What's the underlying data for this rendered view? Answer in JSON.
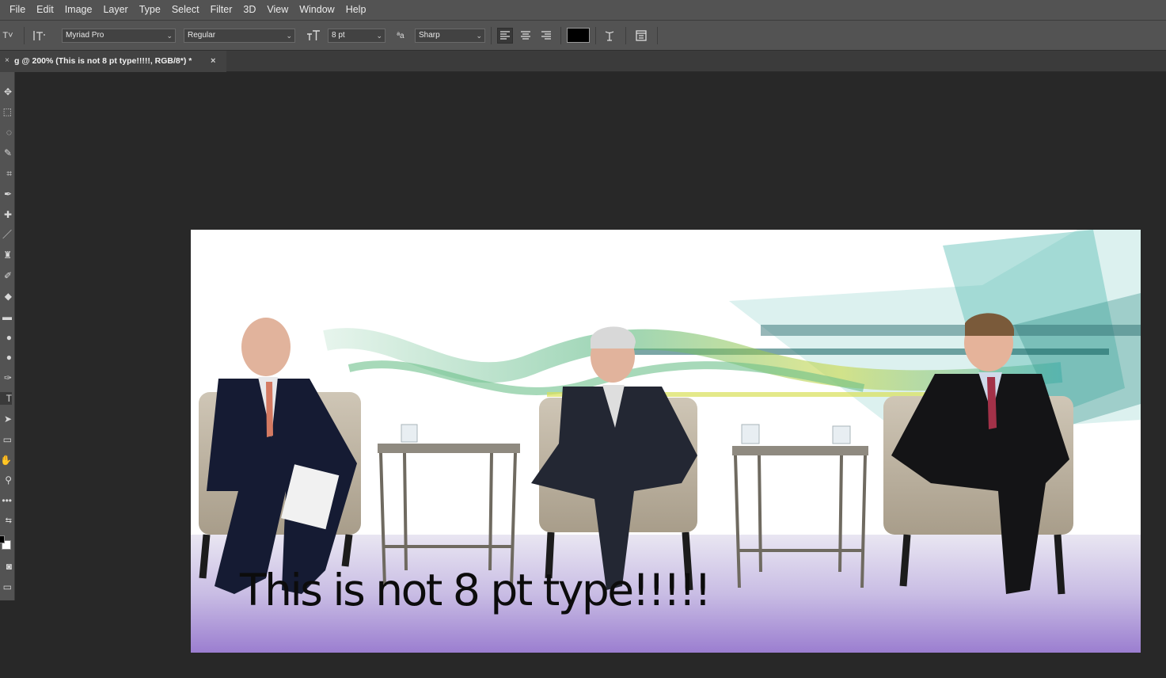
{
  "menu": [
    "File",
    "Edit",
    "Image",
    "Layer",
    "Type",
    "Select",
    "Filter",
    "3D",
    "View",
    "Window",
    "Help"
  ],
  "options": {
    "font_family": "Myriad Pro",
    "font_style": "Regular",
    "font_size": "8 pt",
    "antialias_label": "ªa",
    "antialias": "Sharp",
    "text_color": "#000000"
  },
  "document": {
    "tab_title": "g @ 200% (This is not 8 pt type!!!!!, RGB/8*) *",
    "close_glyph": "×",
    "overlay_text": "This is not 8 pt type!!!!!"
  },
  "colors": {
    "ui_panel": "#535353",
    "workspace": "#282828",
    "foreground": "#000000",
    "background": "#ffffff"
  }
}
